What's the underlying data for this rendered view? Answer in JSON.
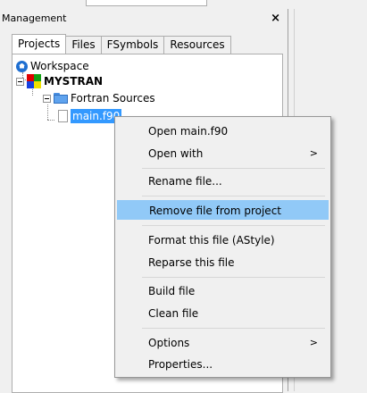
{
  "panel": {
    "title": "Management",
    "close_label": "×"
  },
  "tabs": [
    {
      "label": "Projects",
      "active": true
    },
    {
      "label": "Files",
      "active": false
    },
    {
      "label": "FSymbols",
      "active": false
    },
    {
      "label": "Resources",
      "active": false
    }
  ],
  "tree": {
    "workspace": "Workspace",
    "project": "MYSTRAN",
    "folder": "Fortran Sources",
    "file": "main.f90"
  },
  "context_menu": {
    "items": [
      {
        "label": "Open main.f90",
        "arrow": ""
      },
      {
        "label": "Open with",
        "arrow": ">"
      },
      {
        "label": "Rename file...",
        "arrow": ""
      },
      {
        "label": "Remove file from project",
        "arrow": "",
        "highlight": true
      },
      {
        "label": "Format this file (AStyle)",
        "arrow": ""
      },
      {
        "label": "Reparse this file",
        "arrow": ""
      },
      {
        "label": "Build file",
        "arrow": ""
      },
      {
        "label": "Clean file",
        "arrow": ""
      },
      {
        "label": "Options",
        "arrow": ">"
      },
      {
        "label": "Properties...",
        "arrow": ""
      }
    ]
  },
  "colors": {
    "selection": "#3399ff",
    "menu_highlight": "#91c9f7",
    "workspace_icon": "#1f6fd1",
    "folder_icon": "#5fa3ee"
  },
  "icons": {
    "workspace": "home-globe-icon",
    "project": "four-color-project-icon",
    "folder": "folder-icon",
    "file": "file-icon",
    "submenu": "chevron-right-icon"
  }
}
